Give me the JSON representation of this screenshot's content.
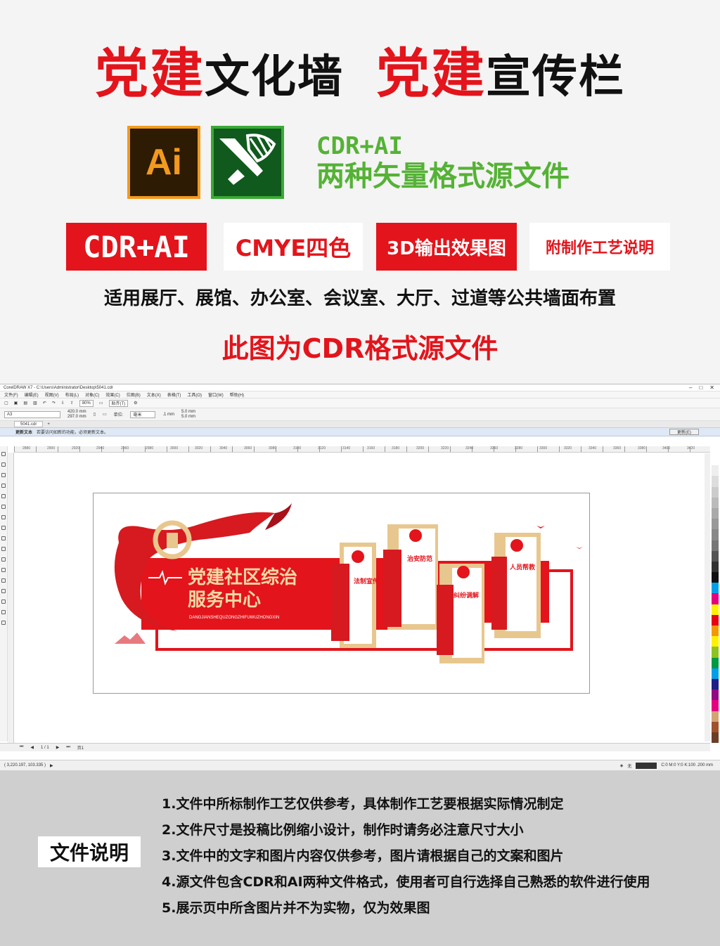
{
  "header": {
    "title_part1_red": "党建",
    "title_part1_black": "文化墙",
    "title_part2_red": "党建",
    "title_part2_black": "宣传栏"
  },
  "formats": {
    "ai_icon_label": "Ai",
    "line1": "CDR+AI",
    "line2": "两种矢量格式源文件"
  },
  "tags": [
    "CDR+AI",
    "CMYE四色",
    "3D输出效果图",
    "附制作工艺说明"
  ],
  "usage_text": "适用展厅、展馆、办公室、会议室、大厅、过道等公共墙面布置",
  "source_note": "此图为CDR格式源文件",
  "app": {
    "window_title": "CorelDRAW X7 - C:\\Users\\Administrator\\Desktop\\5041.cdr",
    "menu": [
      "文件(F)",
      "编辑(E)",
      "视图(V)",
      "布局(L)",
      "对象(C)",
      "效果(C)",
      "位图(B)",
      "文本(X)",
      "表格(T)",
      "工具(O)",
      "窗口(W)",
      "帮助(H)"
    ],
    "zoom": "80%",
    "snap_label": "贴齐(T)",
    "page_size": "A3",
    "width": "420.0 mm",
    "height": "297.0 mm",
    "units_label": "单位:",
    "units": "毫米",
    "nudge": ".1 mm",
    "dup_x": "5.0 mm",
    "dup_y": "5.0 mm",
    "doc_tab": "5041.cdr",
    "update_title": "更新文本",
    "update_msg": "若要访问如新的功能，必须更新文本。",
    "update_button": "更新(E)",
    "ruler_ticks": [
      "2880",
      "2900",
      "2920",
      "2940",
      "2960",
      "2980",
      "3000",
      "3020",
      "3040",
      "3060",
      "3080",
      "3100",
      "3120",
      "3140",
      "3160",
      "3180",
      "3200",
      "3220",
      "3240",
      "3260",
      "3280",
      "3300",
      "3320",
      "3340",
      "3360",
      "3380",
      "3400",
      "3420"
    ],
    "page_indicator": "1 / 1",
    "page_tab": "页1",
    "coords": "( 3,220.197, 103.335 )",
    "fill_none": "无",
    "color_info": "C:0 M:0 Y:0 K:100  .200 mm"
  },
  "design": {
    "main_title_line1": "党建社区综治",
    "main_title_line2": "服务中心",
    "pinyin": "DANGJIANSHEQUZONGZHIFUWUZHONGXIN",
    "panels": [
      {
        "label": "法制宣传"
      },
      {
        "label": "治安防范"
      },
      {
        "label": "纠纷调解"
      },
      {
        "label": "人员帮教"
      }
    ]
  },
  "notes": {
    "label": "文件说明",
    "items": [
      "1.文件中所标制作工艺仅供参考，具体制作工艺要根据实际情况制定",
      "2.文件尺寸是投稿比例缩小设计，制作时请务必注意尺寸大小",
      "3.文件中的文字和图片内容仅供参考，图片请根据自己的文案和图片",
      "4.源文件包含CDR和AI两种文件格式，使用者可自行选择自己熟悉的软件进行使用",
      "5.展示页中所含图片并不为实物，仅为效果图"
    ]
  },
  "colors": {
    "accent_red": "#e3141b",
    "accent_green": "#55b235",
    "ai_orange": "#f29a1e",
    "notes_bg": "#cfcfcf"
  }
}
